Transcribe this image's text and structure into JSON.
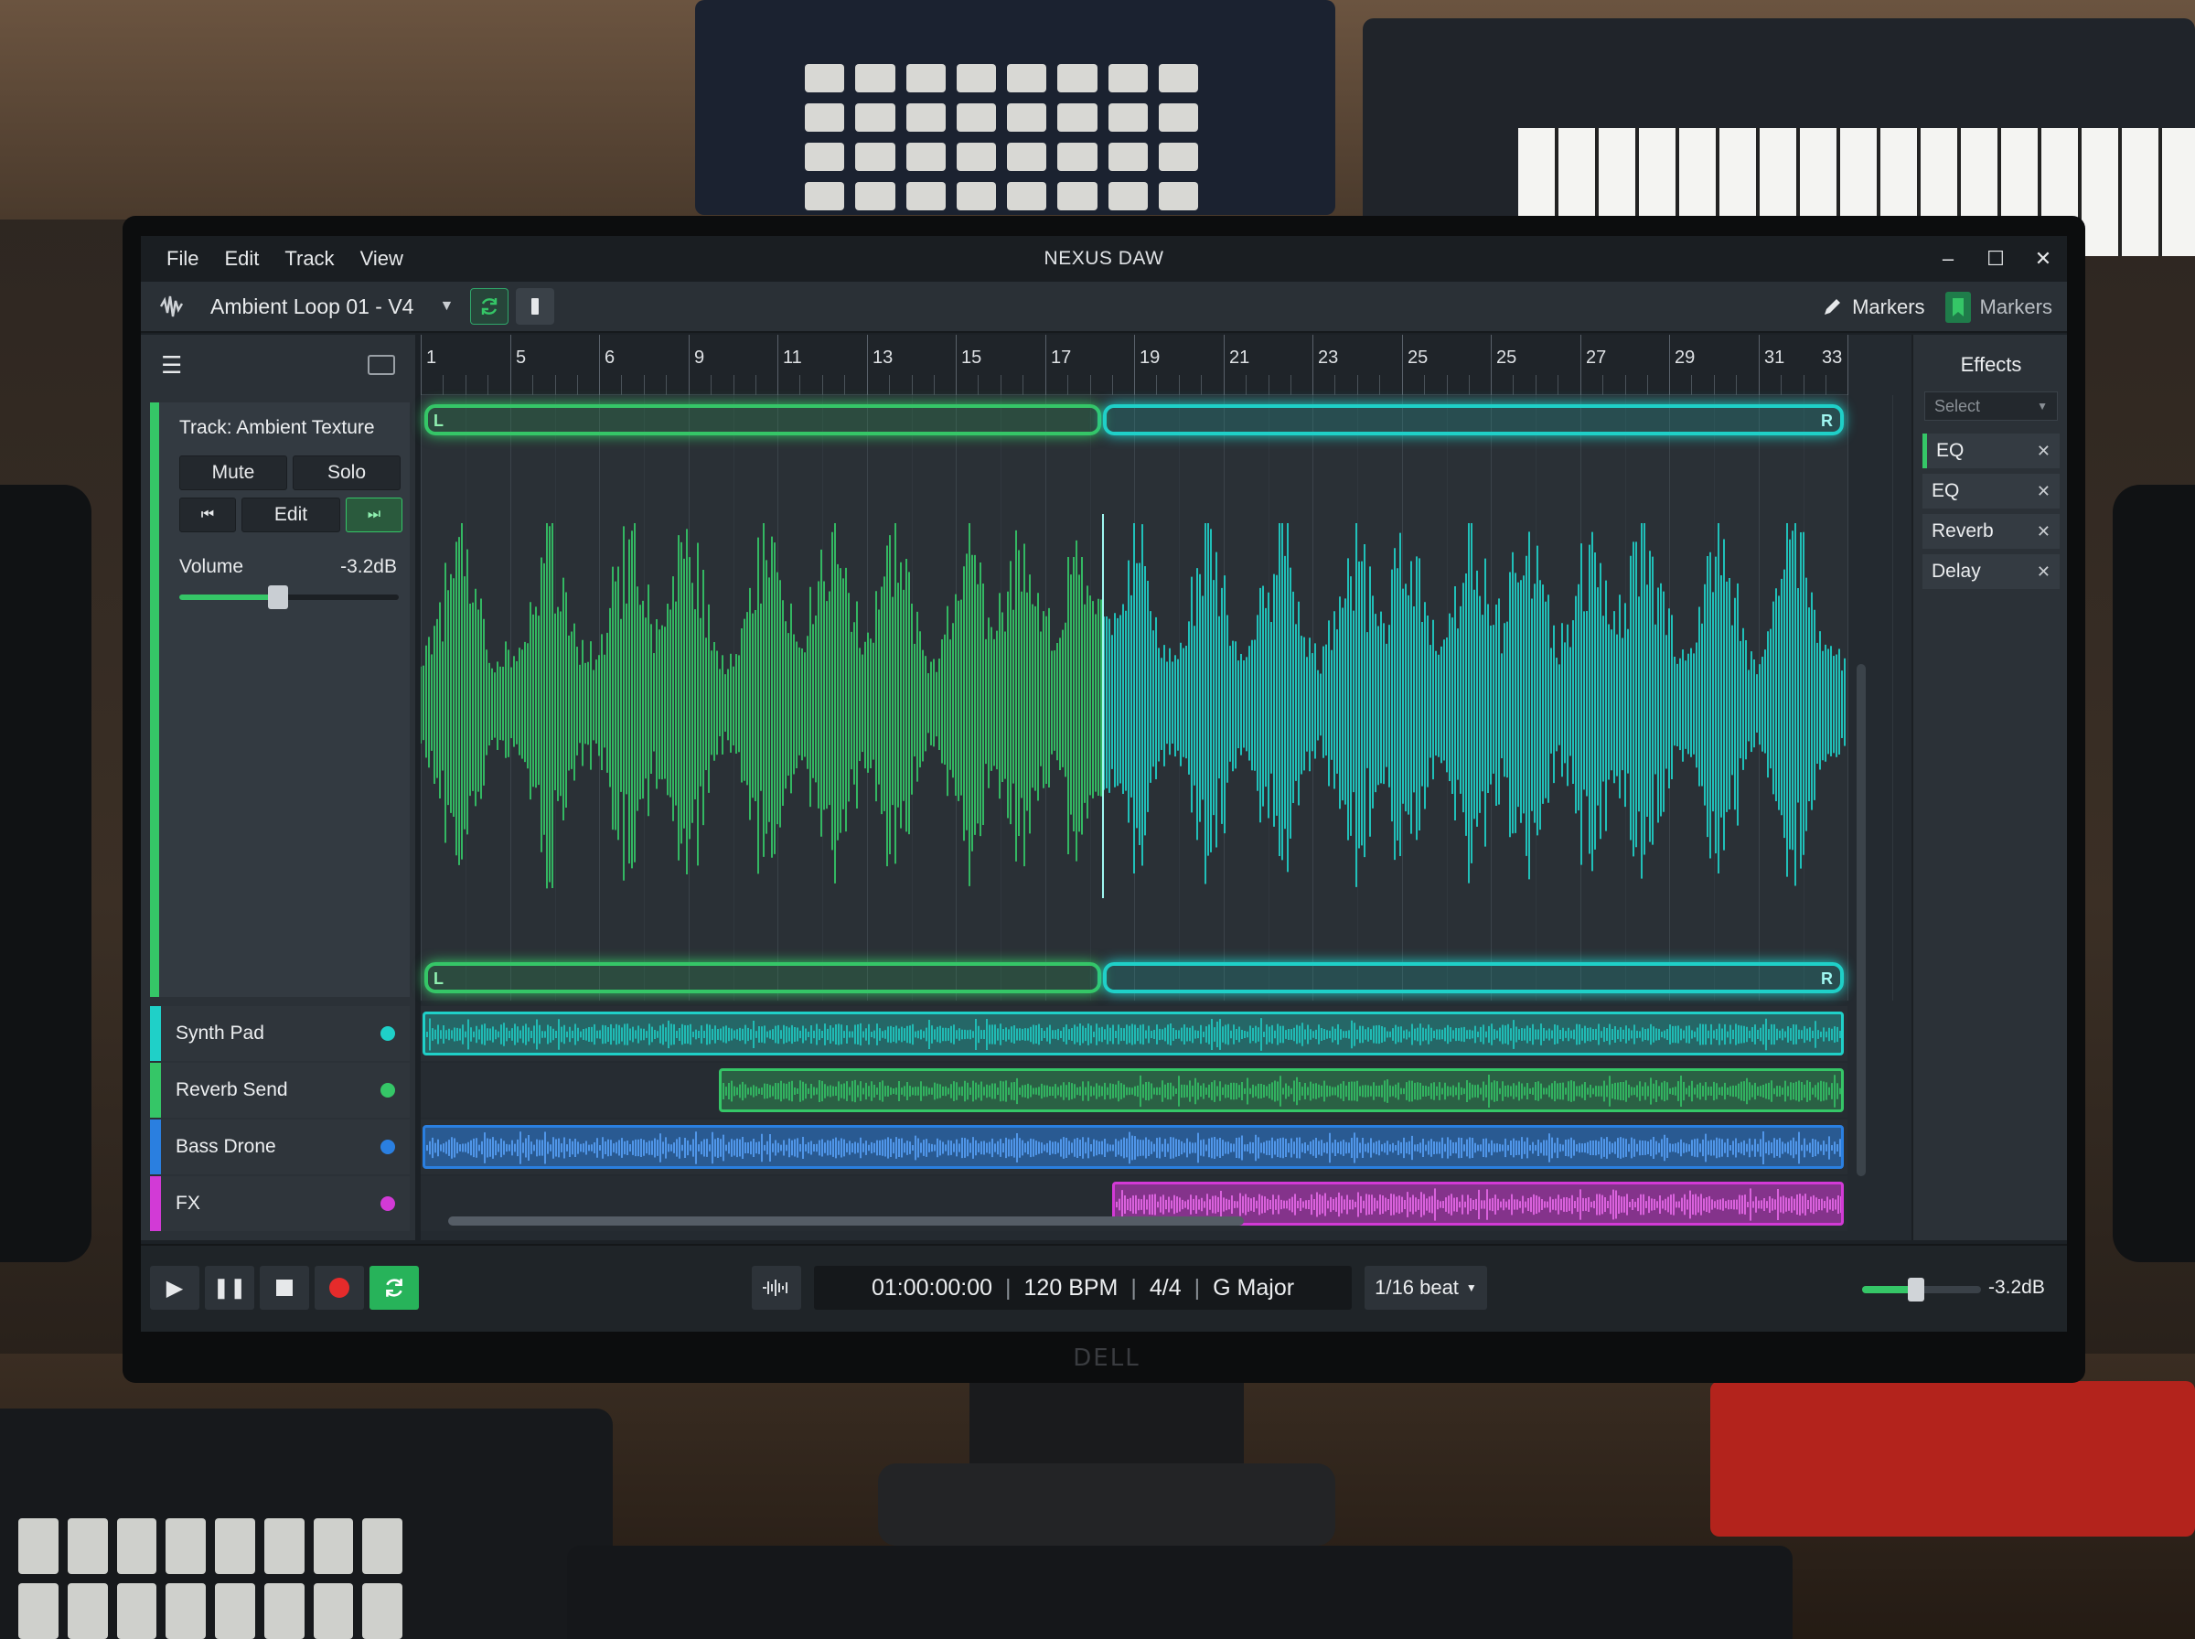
{
  "window": {
    "title": "NEXUS DAW",
    "menu": [
      "File",
      "Edit",
      "Track",
      "View"
    ]
  },
  "toolbar": {
    "project_name": "Ambient Loop 01 - V4",
    "markers_label": "Markers",
    "markers_label_2": "Markers"
  },
  "track_panel": {
    "title": "Track: Ambient Texture",
    "mute_label": "Mute",
    "solo_label": "Solo",
    "edit_label": "Edit",
    "volume_label": "Volume",
    "volume_value": "-3.2dB",
    "volume_level": 0.45,
    "accent": "#35c667"
  },
  "ruler": {
    "labels": [
      "1",
      "5",
      "6",
      "9",
      "11",
      "13",
      "15",
      "17",
      "19",
      "21",
      "23",
      "25",
      "25",
      "27",
      "29",
      "31",
      "33"
    ]
  },
  "loop": {
    "left_letter": "L",
    "right_letter": "R"
  },
  "tracks": [
    {
      "name": "Synth Pad",
      "color": "#1fd0c8"
    },
    {
      "name": "Reverb Send",
      "color": "#35c667"
    },
    {
      "name": "Bass Drone",
      "color": "#2a7fe0"
    },
    {
      "name": "FX",
      "color": "#d23ad6"
    }
  ],
  "effects": {
    "title": "Effects",
    "select_placeholder": "Select",
    "items": [
      "EQ",
      "EQ",
      "Reverb",
      "Delay"
    ]
  },
  "transport": {
    "time": "01:00:00:00",
    "tempo": "120 BPM",
    "signature": "4/4",
    "key": "G Major",
    "snap": "1/16 beat",
    "master_value": "-3.2dB",
    "master_level": 0.45
  },
  "colors": {
    "green": "#35c667",
    "cyan": "#1fd0c8",
    "blue": "#2a7fe0",
    "magenta": "#d23ad6"
  }
}
